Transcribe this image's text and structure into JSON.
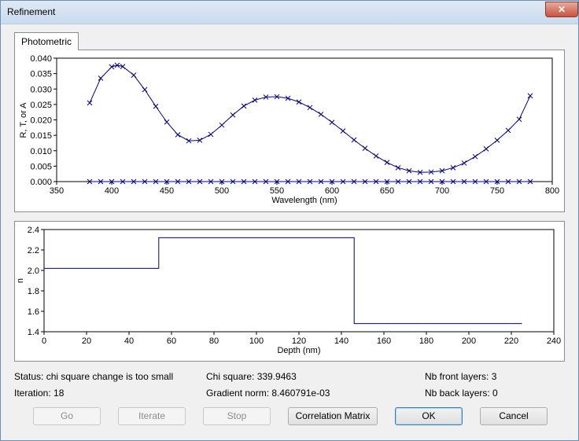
{
  "window": {
    "title": "Refinement",
    "close_label": "✕"
  },
  "tabs": [
    {
      "label": "Photometric"
    }
  ],
  "status": {
    "status_text": "Status: chi square change is too small",
    "iteration_text": "Iteration: 18",
    "chi_square_text": "Chi square: 339.9463",
    "gradient_text": "Gradient norm: 8.460791e-03",
    "nb_front_text": "Nb front layers: 3",
    "nb_back_text": "Nb back layers: 0"
  },
  "buttons": {
    "go": "Go",
    "iterate": "Iterate",
    "stop": "Stop",
    "correlation": "Correlation Matrix",
    "ok": "OK",
    "cancel": "Cancel"
  },
  "colors": {
    "series": "#000080"
  },
  "chart_data": [
    {
      "type": "line",
      "xlabel": "Wavelength (nm)",
      "ylabel": "R, T, or A",
      "xlim": [
        350,
        800
      ],
      "ylim": [
        0,
        0.04
      ],
      "x_ticks": [
        "350",
        "400",
        "450",
        "500",
        "550",
        "600",
        "650",
        "700",
        "750",
        "800"
      ],
      "y_ticks": [
        "0.000",
        "0.005",
        "0.010",
        "0.015",
        "0.020",
        "0.025",
        "0.030",
        "0.035",
        "0.040"
      ],
      "series": [
        {
          "values_x": [
            380,
            390,
            400,
            405,
            410,
            420,
            430,
            440,
            450,
            460,
            470,
            480,
            490,
            500,
            510,
            520,
            530,
            540,
            550,
            560,
            570,
            580,
            590,
            600,
            610,
            620,
            630,
            640,
            650,
            660,
            670,
            680,
            690,
            700,
            710,
            720,
            730,
            740,
            750,
            760,
            770,
            780
          ],
          "values_y": [
            0.0255,
            0.0335,
            0.0372,
            0.0377,
            0.0373,
            0.0345,
            0.0298,
            0.0244,
            0.0193,
            0.0152,
            0.0132,
            0.0134,
            0.0153,
            0.0183,
            0.0216,
            0.0245,
            0.0264,
            0.0274,
            0.0275,
            0.027,
            0.0258,
            0.024,
            0.0218,
            0.0192,
            0.0164,
            0.0135,
            0.0108,
            0.0083,
            0.0062,
            0.0045,
            0.0035,
            0.003,
            0.0031,
            0.0035,
            0.0045,
            0.006,
            0.0081,
            0.0106,
            0.0134,
            0.0166,
            0.0202,
            0.0278
          ]
        },
        {
          "values_x": [
            380,
            780
          ],
          "values_y": [
            0.0,
            0.0
          ]
        }
      ]
    },
    {
      "type": "line",
      "xlabel": "Depth (nm)",
      "ylabel": "n",
      "xlim": [
        0,
        240
      ],
      "ylim": [
        1.4,
        2.4
      ],
      "x_ticks": [
        "0",
        "20",
        "40",
        "60",
        "80",
        "100",
        "120",
        "140",
        "160",
        "180",
        "200",
        "220",
        "240"
      ],
      "y_ticks": [
        "1.4",
        "1.6",
        "1.8",
        "2.0",
        "2.2",
        "2.4"
      ],
      "series": [
        {
          "values_x": [
            0,
            54,
            54,
            146,
            146,
            225
          ],
          "values_y": [
            2.02,
            2.02,
            2.32,
            2.32,
            1.48,
            1.48
          ]
        }
      ]
    }
  ]
}
